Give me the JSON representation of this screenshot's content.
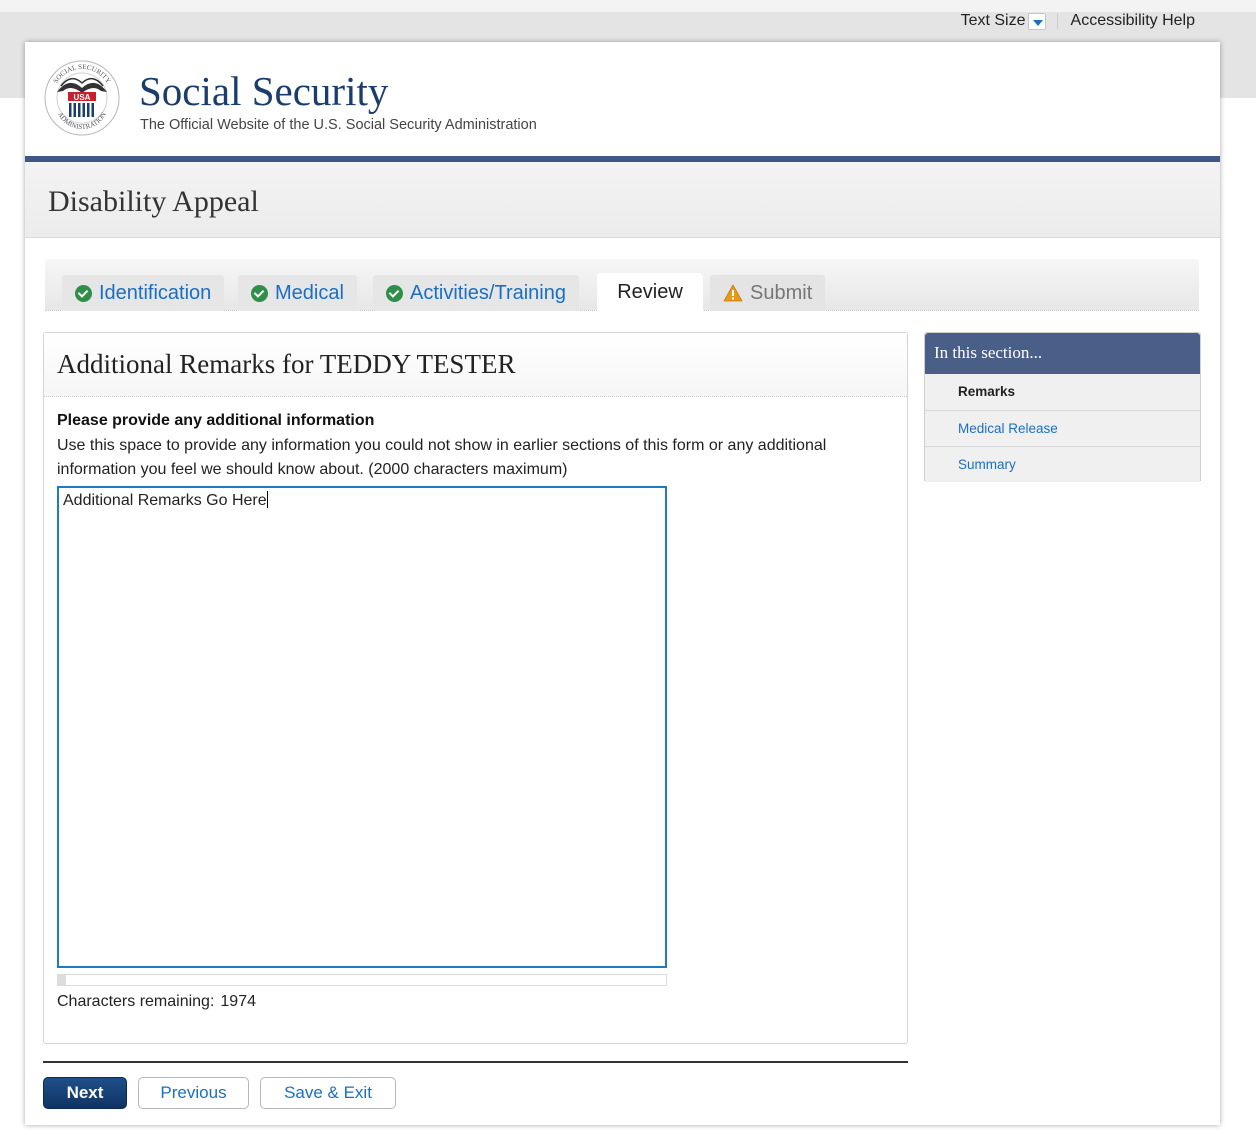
{
  "utility": {
    "text_size": "Text Size",
    "accessibility_help": "Accessibility Help"
  },
  "header": {
    "brand": "Social Security",
    "tagline": "The Official Website of the U.S. Social Security Administration",
    "seal_text": "SOCIAL SECURITY ADMINISTRATION USA",
    "seal_icon": "ssa-seal-icon"
  },
  "banner": {
    "title": "Disability Appeal"
  },
  "tabs": [
    {
      "label": "Identification",
      "state": "complete",
      "icon": "check-circle-icon"
    },
    {
      "label": "Medical",
      "state": "complete",
      "icon": "check-circle-icon"
    },
    {
      "label": "Activities/Training",
      "state": "complete",
      "icon": "check-circle-icon"
    },
    {
      "label": "Review",
      "state": "active"
    },
    {
      "label": "Submit",
      "state": "warning",
      "icon": "warning-icon"
    }
  ],
  "panel": {
    "title": "Additional Remarks for TEDDY TESTER",
    "question_label": "Please provide any additional information",
    "question_help": "Use this space to provide any information you could not show in earlier sections of this form or any additional information you feel we should know about. (2000 characters maximum)",
    "textarea_value": "Additional Remarks Go Here",
    "remaining_label": "Characters remaining:",
    "remaining_count": "1974",
    "max_characters": 2000,
    "used_fraction": 0.013
  },
  "buttons": {
    "next": "Next",
    "previous": "Previous",
    "save_exit": "Save & Exit"
  },
  "sidebar": {
    "heading": "In this section...",
    "items": [
      {
        "label": "Remarks",
        "current": true
      },
      {
        "label": "Medical Release",
        "current": false
      },
      {
        "label": "Summary",
        "current": false
      }
    ]
  },
  "colors": {
    "navy": "#3e5784",
    "brand_text": "#1b3d6d",
    "link": "#1a6fc4",
    "check_green": "#2f8f49",
    "warning": "#e49a1a",
    "primary_button": "#0f3463",
    "textarea_focus": "#1e7bc0"
  }
}
